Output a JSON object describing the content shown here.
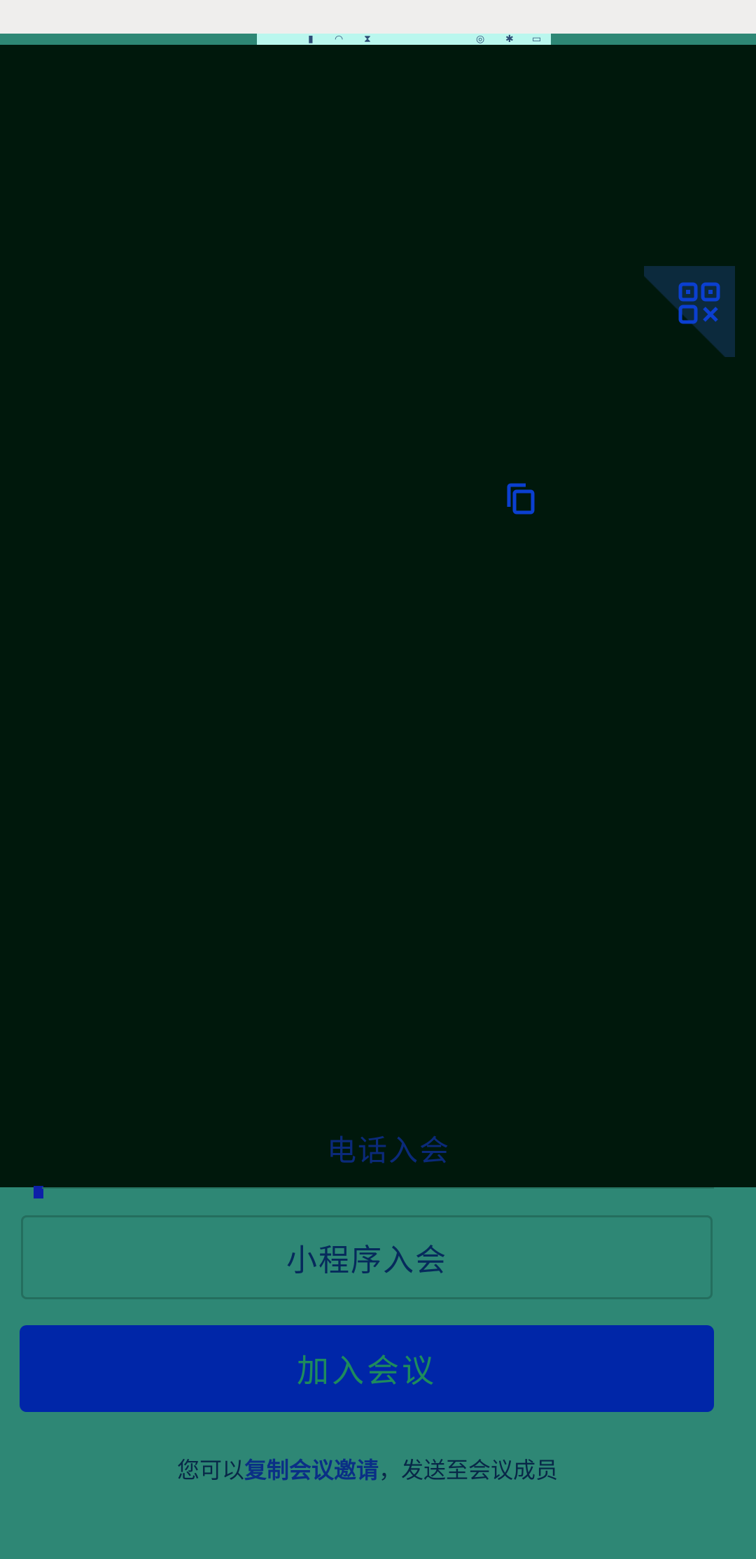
{
  "status_bar": {
    "icons": [
      "signal-icon",
      "wifi-icon",
      "data-icon",
      "alarm-icon",
      "bluetooth-icon",
      "battery-icon"
    ]
  },
  "actions": {
    "phone_join_label": "电话入会",
    "mini_program_label": "小程序入会",
    "join_meeting_label": "加入会议"
  },
  "footer": {
    "prefix": "您可以",
    "link": "复制会议邀请",
    "suffix": "，发送至会议成员"
  },
  "colors": {
    "background": "#2e8775",
    "dark_panel": "#00180c",
    "primary_button": "#0026a8"
  }
}
